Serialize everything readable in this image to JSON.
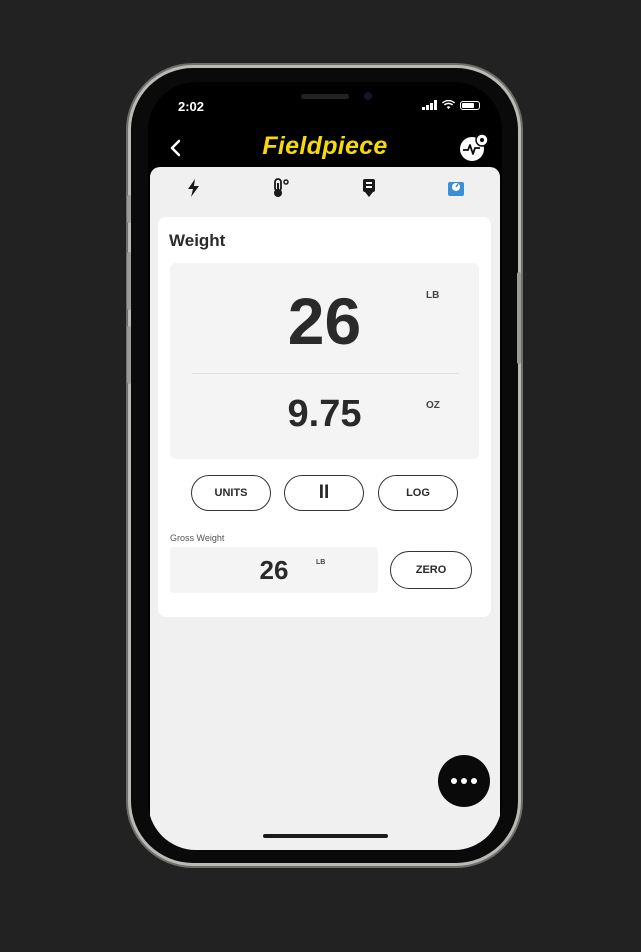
{
  "status_bar": {
    "time": "2:02"
  },
  "header": {
    "brand": "Fieldpiece"
  },
  "tabs": [
    {
      "icon": "lightning-bolt-icon",
      "active": false
    },
    {
      "icon": "thermometer-icon",
      "active": false
    },
    {
      "icon": "refrigerant-tank-icon",
      "active": false
    },
    {
      "icon": "scale-icon",
      "active": true
    }
  ],
  "colors": {
    "accent": "#f5d90a",
    "active_tab": "#3b8fd6",
    "text": "#2a2a2a"
  },
  "weight": {
    "title": "Weight",
    "primary_value": "26",
    "primary_unit": "LB",
    "secondary_value": "9.75",
    "secondary_unit": "OZ"
  },
  "controls": {
    "units_label": "UNITS",
    "pause_label": "II",
    "log_label": "LOG"
  },
  "gross": {
    "label": "Gross Weight",
    "value": "26",
    "unit": "LB",
    "zero_label": "ZERO"
  }
}
